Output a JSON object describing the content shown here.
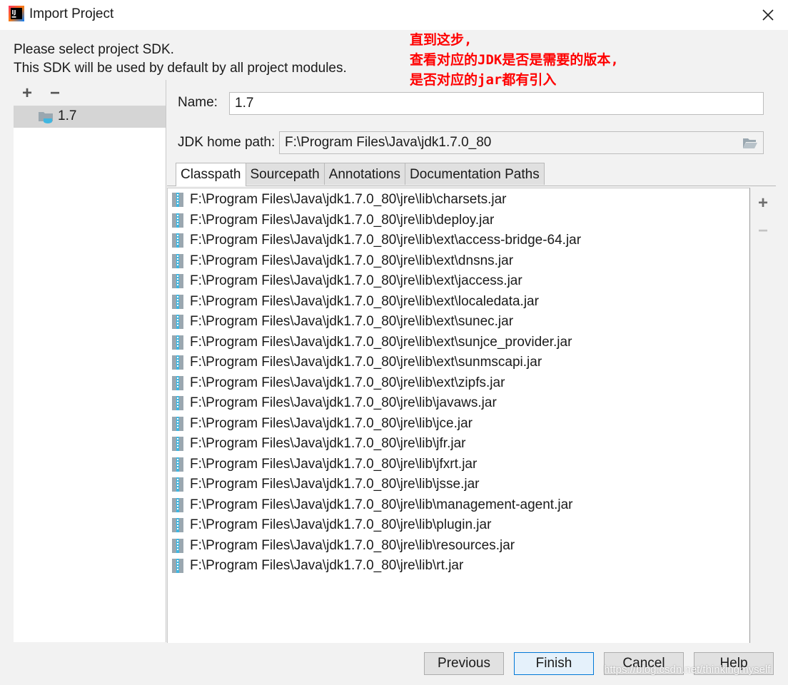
{
  "window": {
    "title": "Import Project"
  },
  "header": {
    "line1": "Please select project SDK.",
    "line2": "This SDK will be used by default by all project modules."
  },
  "annotation": {
    "line1": "直到这步,",
    "line2": "查看对应的JDK是否是需要的版本,",
    "line3": "是否对应的jar都有引入"
  },
  "sdk_list": {
    "add_symbol": "+",
    "remove_symbol": "−",
    "items": [
      {
        "label": "1.7",
        "icon": "sdk-folder-icon"
      }
    ]
  },
  "form": {
    "name_label": "Name:",
    "name_value": "1.7",
    "home_label": "JDK home path:",
    "home_value": "F:\\Program Files\\Java\\jdk1.7.0_80"
  },
  "tabs": [
    {
      "label": "Classpath",
      "active": true
    },
    {
      "label": "Sourcepath",
      "active": false
    },
    {
      "label": "Annotations",
      "active": false
    },
    {
      "label": "Documentation Paths",
      "active": false
    }
  ],
  "classpath": [
    "F:\\Program Files\\Java\\jdk1.7.0_80\\jre\\lib\\charsets.jar",
    "F:\\Program Files\\Java\\jdk1.7.0_80\\jre\\lib\\deploy.jar",
    "F:\\Program Files\\Java\\jdk1.7.0_80\\jre\\lib\\ext\\access-bridge-64.jar",
    "F:\\Program Files\\Java\\jdk1.7.0_80\\jre\\lib\\ext\\dnsns.jar",
    "F:\\Program Files\\Java\\jdk1.7.0_80\\jre\\lib\\ext\\jaccess.jar",
    "F:\\Program Files\\Java\\jdk1.7.0_80\\jre\\lib\\ext\\localedata.jar",
    "F:\\Program Files\\Java\\jdk1.7.0_80\\jre\\lib\\ext\\sunec.jar",
    "F:\\Program Files\\Java\\jdk1.7.0_80\\jre\\lib\\ext\\sunjce_provider.jar",
    "F:\\Program Files\\Java\\jdk1.7.0_80\\jre\\lib\\ext\\sunmscapi.jar",
    "F:\\Program Files\\Java\\jdk1.7.0_80\\jre\\lib\\ext\\zipfs.jar",
    "F:\\Program Files\\Java\\jdk1.7.0_80\\jre\\lib\\javaws.jar",
    "F:\\Program Files\\Java\\jdk1.7.0_80\\jre\\lib\\jce.jar",
    "F:\\Program Files\\Java\\jdk1.7.0_80\\jre\\lib\\jfr.jar",
    "F:\\Program Files\\Java\\jdk1.7.0_80\\jre\\lib\\jfxrt.jar",
    "F:\\Program Files\\Java\\jdk1.7.0_80\\jre\\lib\\jsse.jar",
    "F:\\Program Files\\Java\\jdk1.7.0_80\\jre\\lib\\management-agent.jar",
    "F:\\Program Files\\Java\\jdk1.7.0_80\\jre\\lib\\plugin.jar",
    "F:\\Program Files\\Java\\jdk1.7.0_80\\jre\\lib\\resources.jar",
    "F:\\Program Files\\Java\\jdk1.7.0_80\\jre\\lib\\rt.jar"
  ],
  "side_toolbar": {
    "add_symbol": "+",
    "remove_symbol": "−"
  },
  "buttons": {
    "previous": "Previous",
    "finish": "Finish",
    "cancel": "Cancel",
    "help": "Help"
  },
  "watermark": "https://blog.csdn.net/thinkingmyself",
  "colors": {
    "annotation": "#ff0000",
    "selection": "#d5d5d5",
    "default_button_border": "#0078d7"
  }
}
